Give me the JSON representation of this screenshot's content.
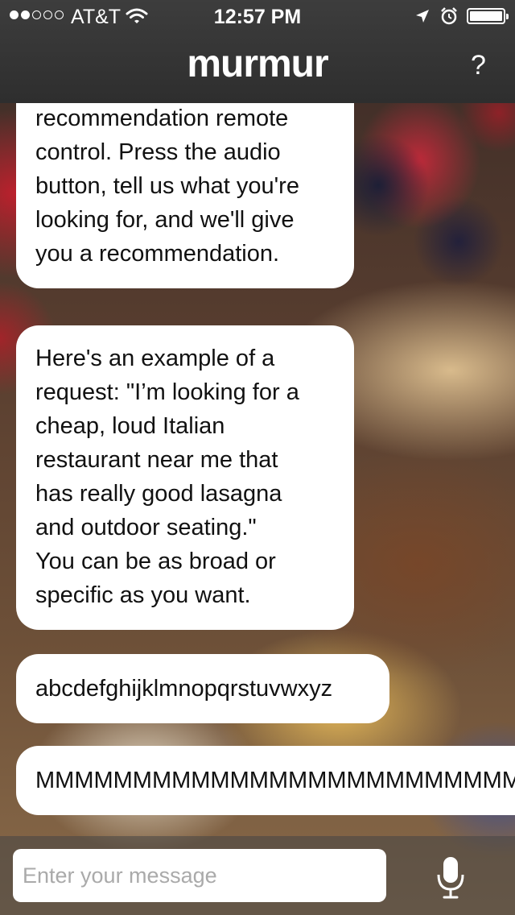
{
  "status_bar": {
    "carrier": "AT&T",
    "time": "12:57 PM",
    "signal_bars_filled": 2,
    "signal_bars_total": 5,
    "battery_level": 1.0
  },
  "header": {
    "app_title": "murmur",
    "help_label": "?"
  },
  "messages": [
    {
      "text": "restaurant\nrecommendation remote\ncontrol. Press the audio\nbutton, tell us what you're\nlooking for, and we'll give\nyou a recommendation."
    },
    {
      "text": "Here's an example of a\nrequest: \"I’m looking for a\ncheap, loud Italian\nrestaurant near me that\nhas really good lasagna\nand outdoor seating.\"\nYou can be as broad or\nspecific as you want."
    },
    {
      "text": "abcdefghijklmnopqrstuvwxyz"
    },
    {
      "text": "MMMMMMMMMMMMMMMMMMMMMMMMM"
    }
  ],
  "composer": {
    "placeholder": "Enter your message",
    "value": ""
  },
  "icons": {
    "wifi": "wifi-icon",
    "location": "location-arrow-icon",
    "alarm": "alarm-clock-icon",
    "battery": "battery-icon",
    "mic": "microphone-icon"
  }
}
